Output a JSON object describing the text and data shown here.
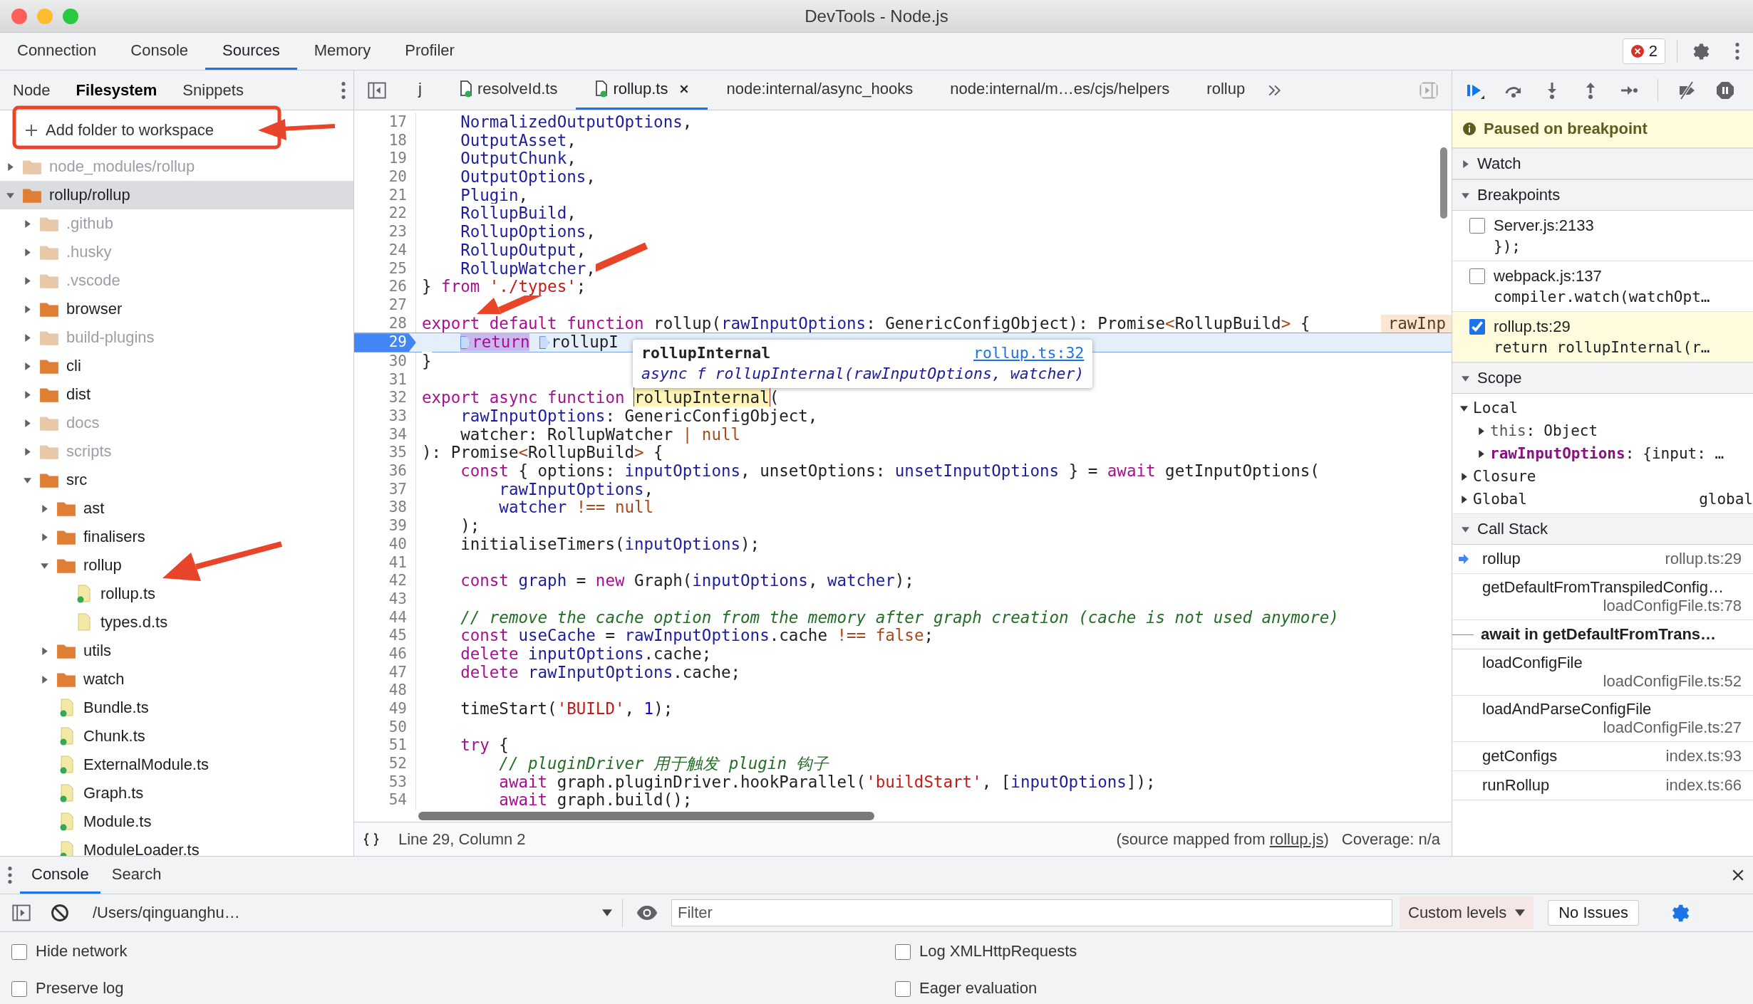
{
  "window": {
    "title": "DevTools - Node.js"
  },
  "main_tabs": [
    {
      "label": "Connection",
      "selected": false
    },
    {
      "label": "Console",
      "selected": false
    },
    {
      "label": "Sources",
      "selected": true
    },
    {
      "label": "Memory",
      "selected": false
    },
    {
      "label": "Profiler",
      "selected": false
    }
  ],
  "error_count": "2",
  "navigator": {
    "tabs": [
      {
        "label": "Node",
        "selected": false
      },
      {
        "label": "Filesystem",
        "selected": true
      },
      {
        "label": "Snippets",
        "selected": false
      }
    ],
    "add_folder": "Add folder to workspace",
    "tree": [
      {
        "name": "node_modules/rollup",
        "kind": "folder",
        "dimmed": true,
        "expanded": false,
        "selected": false
      },
      {
        "name": "rollup/rollup",
        "kind": "folder",
        "dimmed": false,
        "expanded": true,
        "selected": true,
        "children": [
          {
            "name": ".github",
            "kind": "folder",
            "dimmed": true,
            "expanded": false,
            "selected": false
          },
          {
            "name": ".husky",
            "kind": "folder",
            "dimmed": true,
            "expanded": false,
            "selected": false
          },
          {
            "name": ".vscode",
            "kind": "folder",
            "dimmed": true,
            "expanded": false,
            "selected": false
          },
          {
            "name": "browser",
            "kind": "folder",
            "dimmed": false,
            "expanded": false,
            "selected": false
          },
          {
            "name": "build-plugins",
            "kind": "folder",
            "dimmed": true,
            "expanded": false,
            "selected": false
          },
          {
            "name": "cli",
            "kind": "folder",
            "dimmed": false,
            "expanded": false,
            "selected": false
          },
          {
            "name": "dist",
            "kind": "folder",
            "dimmed": false,
            "expanded": false,
            "selected": false
          },
          {
            "name": "docs",
            "kind": "folder",
            "dimmed": true,
            "expanded": false,
            "selected": false
          },
          {
            "name": "scripts",
            "kind": "folder",
            "dimmed": true,
            "expanded": false,
            "selected": false
          },
          {
            "name": "src",
            "kind": "folder",
            "dimmed": false,
            "expanded": true,
            "selected": false,
            "children": [
              {
                "name": "ast",
                "kind": "folder",
                "dimmed": false,
                "expanded": false,
                "selected": false
              },
              {
                "name": "finalisers",
                "kind": "folder",
                "dimmed": false,
                "expanded": false,
                "selected": false
              },
              {
                "name": "rollup",
                "kind": "folder",
                "dimmed": false,
                "expanded": true,
                "selected": false,
                "children": [
                  {
                    "name": "rollup.ts",
                    "kind": "file",
                    "synced": true,
                    "selected": false
                  },
                  {
                    "name": "types.d.ts",
                    "kind": "file",
                    "synced": false,
                    "selected": false
                  }
                ]
              },
              {
                "name": "utils",
                "kind": "folder",
                "dimmed": false,
                "expanded": false,
                "selected": false
              },
              {
                "name": "watch",
                "kind": "folder",
                "dimmed": false,
                "expanded": false,
                "selected": false
              },
              {
                "name": "Bundle.ts",
                "kind": "file",
                "synced": true,
                "selected": false
              },
              {
                "name": "Chunk.ts",
                "kind": "file",
                "synced": true,
                "selected": false
              },
              {
                "name": "ExternalModule.ts",
                "kind": "file",
                "synced": true,
                "selected": false
              },
              {
                "name": "Graph.ts",
                "kind": "file",
                "synced": true,
                "selected": false
              },
              {
                "name": "Module.ts",
                "kind": "file",
                "synced": true,
                "selected": false
              },
              {
                "name": "ModuleLoader.ts",
                "kind": "file",
                "synced": true,
                "selected": false
              }
            ]
          }
        ]
      }
    ]
  },
  "editor": {
    "tabs": [
      {
        "label": "j",
        "kind": "plain",
        "selected": false
      },
      {
        "label": "resolveId.ts",
        "kind": "file",
        "selected": false
      },
      {
        "label": "rollup.ts",
        "kind": "file",
        "selected": true
      },
      {
        "label": "node:internal/async_hooks",
        "kind": "plain",
        "selected": false
      },
      {
        "label": "node:internal/m…es/cjs/helpers",
        "kind": "plain",
        "selected": false
      },
      {
        "label": "rollup",
        "kind": "plain",
        "selected": false
      }
    ],
    "lines": [
      {
        "number": "17",
        "breakpoint": false,
        "tokens": [
          {
            "kind": "name",
            "text": "    NormalizedOutputOptions"
          },
          {
            "kind": "plain",
            "text": ","
          }
        ]
      },
      {
        "number": "18",
        "breakpoint": false,
        "tokens": [
          {
            "kind": "name",
            "text": "    OutputAsset"
          },
          {
            "kind": "plain",
            "text": ","
          }
        ]
      },
      {
        "number": "19",
        "breakpoint": false,
        "tokens": [
          {
            "kind": "name",
            "text": "    OutputChunk"
          },
          {
            "kind": "plain",
            "text": ","
          }
        ]
      },
      {
        "number": "20",
        "breakpoint": false,
        "tokens": [
          {
            "kind": "name",
            "text": "    OutputOptions"
          },
          {
            "kind": "plain",
            "text": ","
          }
        ]
      },
      {
        "number": "21",
        "breakpoint": false,
        "tokens": [
          {
            "kind": "name",
            "text": "    Plugin"
          },
          {
            "kind": "plain",
            "text": ","
          }
        ]
      },
      {
        "number": "22",
        "breakpoint": false,
        "tokens": [
          {
            "kind": "name",
            "text": "    RollupBuild"
          },
          {
            "kind": "plain",
            "text": ","
          }
        ]
      },
      {
        "number": "23",
        "breakpoint": false,
        "tokens": [
          {
            "kind": "name",
            "text": "    RollupOptions"
          },
          {
            "kind": "plain",
            "text": ","
          }
        ]
      },
      {
        "number": "24",
        "breakpoint": false,
        "tokens": [
          {
            "kind": "name",
            "text": "    RollupOutput"
          },
          {
            "kind": "plain",
            "text": ","
          }
        ]
      },
      {
        "number": "25",
        "breakpoint": false,
        "tokens": [
          {
            "kind": "name",
            "text": "    RollupWatcher"
          },
          {
            "kind": "plain",
            "text": ","
          }
        ]
      },
      {
        "number": "26",
        "breakpoint": false,
        "tokens": [
          {
            "kind": "plain",
            "text": "} "
          },
          {
            "kind": "keyword",
            "text": "from"
          },
          {
            "kind": "string",
            "text": " './types'"
          },
          {
            "kind": "plain",
            "text": ";"
          }
        ]
      },
      {
        "number": "27",
        "breakpoint": false
      },
      {
        "number": "28",
        "breakpoint": false,
        "tokens": [
          {
            "kind": "keyword",
            "text": "export default function"
          },
          {
            "kind": "plain",
            "text": " rollup("
          },
          {
            "kind": "name",
            "text": "rawInputOptions"
          },
          {
            "kind": "plain",
            "text": ": GenericConfigObject): Promise"
          },
          {
            "kind": "op",
            "text": "<"
          },
          {
            "kind": "plain",
            "text": "RollupBuild"
          },
          {
            "kind": "op",
            "text": ">"
          },
          {
            "kind": "plain",
            "text": " {"
          }
        ],
        "inline_value": "rawInp"
      },
      {
        "number": "29",
        "breakpoint": true,
        "tokens": [
          {
            "kind": "keyword",
            "text": "    return",
            "marker": true,
            "highlighted": true
          },
          {
            "kind": "plain",
            "text": " rollupI",
            "marker": true,
            "highlighted": false
          }
        ]
      },
      {
        "number": "30",
        "breakpoint": false,
        "tokens": [
          {
            "kind": "plain",
            "text": "}"
          }
        ]
      },
      {
        "number": "31",
        "breakpoint": false
      },
      {
        "number": "32",
        "breakpoint": false,
        "tokens": [
          {
            "kind": "keyword",
            "text": "export async function "
          },
          {
            "kind": "plain",
            "text": "rollupInternal",
            "highlighted": true
          },
          {
            "kind": "plain",
            "text": "("
          }
        ]
      },
      {
        "number": "33",
        "breakpoint": false,
        "tokens": [
          {
            "kind": "name",
            "text": "    rawInputOptions"
          },
          {
            "kind": "plain",
            "text": ": GenericConfigObject,"
          }
        ]
      },
      {
        "number": "34",
        "breakpoint": false,
        "tokens": [
          {
            "kind": "plain",
            "text": "    watcher: RollupWatcher "
          },
          {
            "kind": "op",
            "text": "| null"
          }
        ]
      },
      {
        "number": "35",
        "breakpoint": false,
        "tokens": [
          {
            "kind": "plain",
            "text": "): Promise"
          },
          {
            "kind": "op",
            "text": "<"
          },
          {
            "kind": "plain",
            "text": "RollupBuild"
          },
          {
            "kind": "op",
            "text": ">"
          },
          {
            "kind": "plain",
            "text": " {"
          }
        ]
      },
      {
        "number": "36",
        "breakpoint": false,
        "tokens": [
          {
            "kind": "keyword",
            "text": "    const"
          },
          {
            "kind": "plain",
            "text": " { options: "
          },
          {
            "kind": "name",
            "text": "inputOptions"
          },
          {
            "kind": "plain",
            "text": ", unsetOptions: "
          },
          {
            "kind": "name",
            "text": "unsetInputOptions"
          },
          {
            "kind": "plain",
            "text": " } = "
          },
          {
            "kind": "keyword",
            "text": "await"
          },
          {
            "kind": "plain",
            "text": " getInputOptions("
          }
        ]
      },
      {
        "number": "37",
        "breakpoint": false,
        "tokens": [
          {
            "kind": "name",
            "text": "        rawInputOptions"
          },
          {
            "kind": "plain",
            "text": ","
          }
        ]
      },
      {
        "number": "38",
        "breakpoint": false,
        "tokens": [
          {
            "kind": "name",
            "text": "        watcher "
          },
          {
            "kind": "op",
            "text": "!== null"
          }
        ]
      },
      {
        "number": "39",
        "breakpoint": false,
        "tokens": [
          {
            "kind": "plain",
            "text": "    );"
          }
        ]
      },
      {
        "number": "40",
        "breakpoint": false,
        "tokens": [
          {
            "kind": "plain",
            "text": "    initialiseTimers("
          },
          {
            "kind": "name",
            "text": "inputOptions"
          },
          {
            "kind": "plain",
            "text": ");"
          }
        ]
      },
      {
        "number": "41",
        "breakpoint": false
      },
      {
        "number": "42",
        "breakpoint": false,
        "tokens": [
          {
            "kind": "keyword",
            "text": "    const"
          },
          {
            "kind": "name",
            "text": " graph"
          },
          {
            "kind": "plain",
            "text": " = "
          },
          {
            "kind": "keyword",
            "text": "new"
          },
          {
            "kind": "plain",
            "text": " Graph("
          },
          {
            "kind": "name",
            "text": "inputOptions"
          },
          {
            "kind": "plain",
            "text": ", "
          },
          {
            "kind": "name",
            "text": "watcher"
          },
          {
            "kind": "plain",
            "text": ");"
          }
        ]
      },
      {
        "number": "43",
        "breakpoint": false
      },
      {
        "number": "44",
        "breakpoint": false,
        "tokens": [
          {
            "kind": "comment",
            "text": "    // remove the cache option from the memory after graph creation (cache is not used anymore)"
          }
        ]
      },
      {
        "number": "45",
        "breakpoint": false,
        "tokens": [
          {
            "kind": "keyword",
            "text": "    const"
          },
          {
            "kind": "name",
            "text": " useCache"
          },
          {
            "kind": "plain",
            "text": " = "
          },
          {
            "kind": "name",
            "text": "rawInputOptions"
          },
          {
            "kind": "plain",
            "text": ".cache "
          },
          {
            "kind": "op",
            "text": "!== false"
          },
          {
            "kind": "plain",
            "text": ";"
          }
        ]
      },
      {
        "number": "46",
        "breakpoint": false,
        "tokens": [
          {
            "kind": "keyword",
            "text": "    delete"
          },
          {
            "kind": "name",
            "text": " inputOptions"
          },
          {
            "kind": "plain",
            "text": ".cache;"
          }
        ]
      },
      {
        "number": "47",
        "breakpoint": false,
        "tokens": [
          {
            "kind": "keyword",
            "text": "    delete"
          },
          {
            "kind": "name",
            "text": " rawInputOptions"
          },
          {
            "kind": "plain",
            "text": ".cache;"
          }
        ]
      },
      {
        "number": "48",
        "breakpoint": false
      },
      {
        "number": "49",
        "breakpoint": false,
        "tokens": [
          {
            "kind": "plain",
            "text": "    timeStart("
          },
          {
            "kind": "string",
            "text": "'BUILD'"
          },
          {
            "kind": "plain",
            "text": ", "
          },
          {
            "kind": "number",
            "text": "1"
          },
          {
            "kind": "plain",
            "text": ");"
          }
        ]
      },
      {
        "number": "50",
        "breakpoint": false
      },
      {
        "number": "51",
        "breakpoint": false,
        "tokens": [
          {
            "kind": "keyword",
            "text": "    try"
          },
          {
            "kind": "plain",
            "text": " {"
          }
        ]
      },
      {
        "number": "52",
        "breakpoint": false,
        "tokens": [
          {
            "kind": "comment",
            "text": "        // pluginDriver 用于触发 plugin 钩子"
          }
        ]
      },
      {
        "number": "53",
        "breakpoint": false,
        "tokens": [
          {
            "kind": "keyword",
            "text": "        await"
          },
          {
            "kind": "plain",
            "text": " graph.pluginDriver.hookParallel("
          },
          {
            "kind": "string",
            "text": "'buildStart'"
          },
          {
            "kind": "plain",
            "text": ", ["
          },
          {
            "kind": "name",
            "text": "inputOptions"
          },
          {
            "kind": "plain",
            "text": "]);"
          }
        ]
      },
      {
        "number": "54",
        "breakpoint": false,
        "tokens": [
          {
            "kind": "keyword",
            "text": "        await"
          },
          {
            "kind": "plain",
            "text": " graph.build();"
          }
        ]
      }
    ],
    "tooltip": {
      "title": "rollupInternal",
      "link": "rollup.ts:32",
      "signature": "async f rollupInternal(rawInputOptions, watcher)"
    },
    "status": {
      "position": "Line 29, Column 2",
      "source_prefix": "(source mapped from ",
      "source_link": "rollup.js",
      "source_suffix": ")",
      "coverage": "Coverage: n/a"
    }
  },
  "debugger": {
    "banner": "Paused on breakpoint",
    "watch": {
      "title": "Watch",
      "expanded": false
    },
    "breakpoints": {
      "title": "Breakpoints",
      "expanded": true,
      "items": [
        {
          "file": "Server.js:2133",
          "code": "});",
          "checked": false,
          "hit": false
        },
        {
          "file": "webpack.js:137",
          "code": "compiler.watch(watchOpt…",
          "checked": false,
          "hit": false
        },
        {
          "file": "rollup.ts:29",
          "code": "return rollupInternal(r…",
          "checked": true,
          "hit": true
        }
      ]
    },
    "scope": {
      "title": "Scope",
      "expanded": true,
      "items": [
        {
          "name": "Local",
          "kind": "scope",
          "expanded": true,
          "children": [
            {
              "name": "this",
              "separator": ":",
              "value": "Object",
              "kind": "property",
              "expanded": false
            },
            {
              "name": "rawInputOptions",
              "separator": ":",
              "value": "{input: …",
              "kind": "own_property",
              "expanded": false
            }
          ]
        },
        {
          "name": "Closure",
          "kind": "scope",
          "expanded": false
        },
        {
          "name": "Global",
          "value": "global",
          "kind": "scope",
          "expanded": false
        }
      ]
    },
    "call_stack": {
      "title": "Call Stack",
      "expanded": true,
      "frames": [
        {
          "name": "rollup",
          "location": "rollup.ts:29",
          "kind": "inline",
          "current": true
        },
        {
          "name": "getDefaultFromTranspiledConfig…",
          "location": "loadConfigFile.ts:78",
          "kind": "stacked",
          "current": false
        },
        {
          "name": "await in getDefaultFromTrans…",
          "kind": "async",
          "current": false
        },
        {
          "name": "loadConfigFile",
          "location": "loadConfigFile.ts:52",
          "kind": "stacked",
          "current": false
        },
        {
          "name": "loadAndParseConfigFile",
          "location": "loadConfigFile.ts:27",
          "kind": "stacked",
          "current": false
        },
        {
          "name": "getConfigs",
          "location": "index.ts:93",
          "kind": "inline",
          "current": false
        },
        {
          "name": "runRollup",
          "location": "index.ts:66",
          "kind": "inline",
          "current": false
        }
      ]
    }
  },
  "drawer": {
    "tabs": [
      {
        "label": "Console",
        "selected": true
      },
      {
        "label": "Search",
        "selected": false
      }
    ],
    "context": "/Users/qinguanghu…",
    "filter": {
      "placeholder": "Filter"
    },
    "levels": "Custom levels",
    "issues": "No Issues",
    "options": [
      {
        "label": "Hide network",
        "checked": false
      },
      {
        "label": "Log XMLHttpRequests",
        "checked": false
      },
      {
        "label": "Preserve log",
        "checked": false
      },
      {
        "label": "Eager evaluation",
        "checked": false
      }
    ]
  }
}
